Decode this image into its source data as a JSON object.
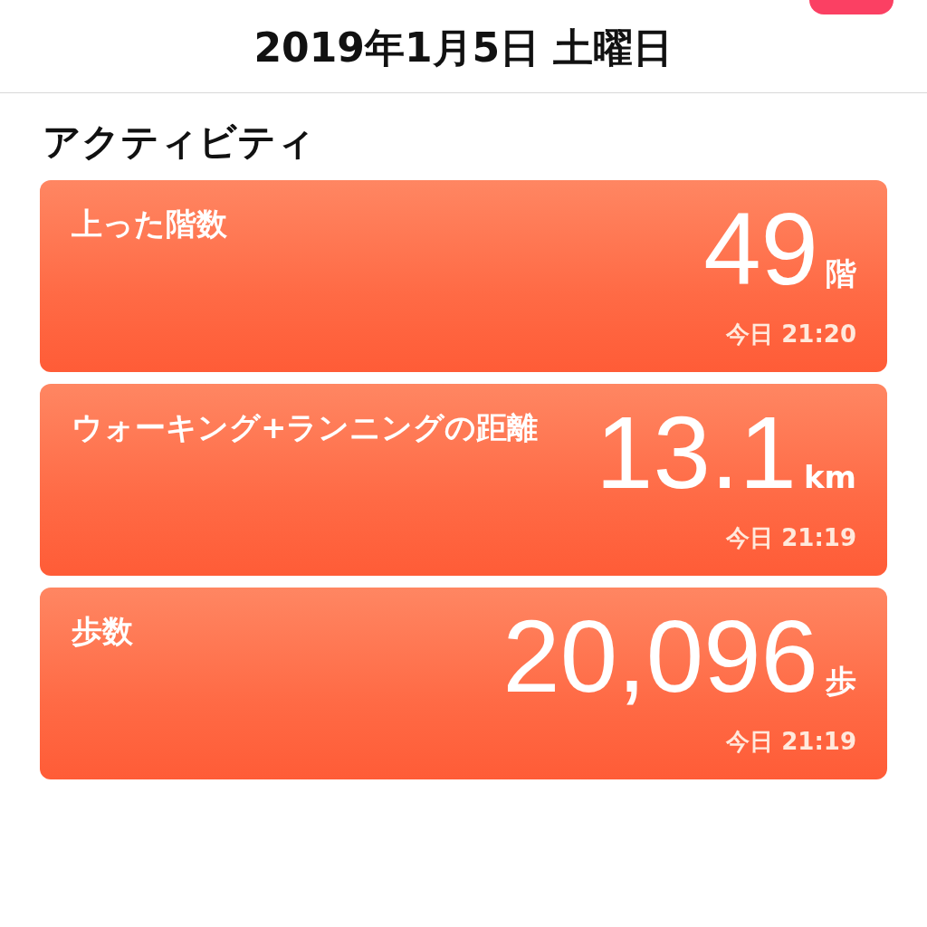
{
  "header": {
    "title": "2019年1月5日 土曜日"
  },
  "section": {
    "title": "アクティビティ"
  },
  "metrics": [
    {
      "label": "上った階数",
      "value": "49",
      "unit": "階",
      "time": "今日 21:20"
    },
    {
      "label": "ウォーキング+ランニングの距離",
      "value": "13.1",
      "unit": "km",
      "time": "今日 21:19"
    },
    {
      "label": "歩数",
      "value": "20,096",
      "unit": "歩",
      "time": "今日 21:19"
    }
  ]
}
